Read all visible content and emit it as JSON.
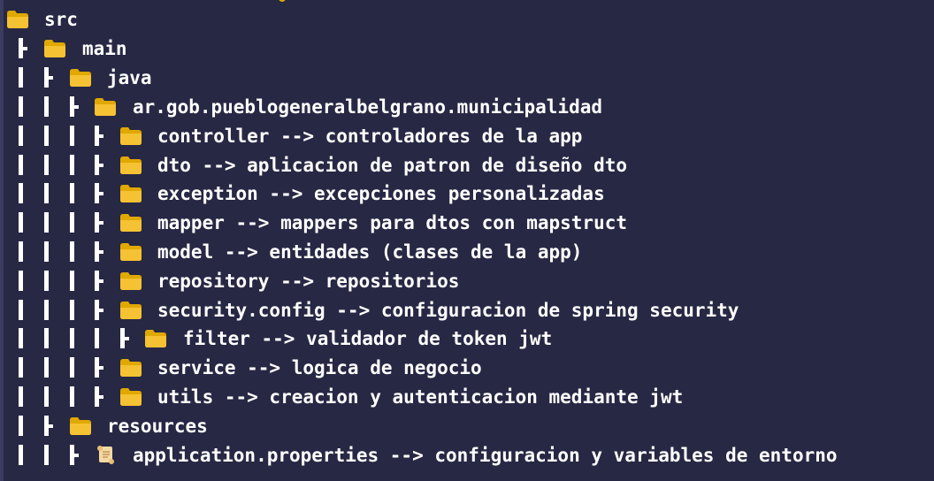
{
  "tree": [
    {
      "label": "src",
      "icon": "folder-icon"
    },
    {
      "label": "main",
      "icon": "folder-icon"
    },
    {
      "label": "java",
      "icon": "folder-icon"
    },
    {
      "label": "ar.gob.pueblogeneralbelgrano.municipalidad",
      "icon": "folder-icon"
    },
    {
      "label": "controller --> controladores de la app",
      "icon": "folder-icon"
    },
    {
      "label": "dto --> aplicacion de patron de diseño dto",
      "icon": "folder-icon"
    },
    {
      "label": "exception --> excepciones personalizadas",
      "icon": "folder-icon"
    },
    {
      "label": "mapper --> mappers para dtos con mapstruct",
      "icon": "folder-icon"
    },
    {
      "label": "model --> entidades (clases de la app)",
      "icon": "folder-icon"
    },
    {
      "label": "repository --> repositorios",
      "icon": "folder-icon"
    },
    {
      "label": "security.config --> configuracion de spring security",
      "icon": "folder-icon"
    },
    {
      "label": "filter --> validador de token jwt",
      "icon": "folder-icon"
    },
    {
      "label": "service --> logica de negocio",
      "icon": "folder-icon"
    },
    {
      "label": "utils --> creacion y autenticacion mediante jwt",
      "icon": "folder-icon"
    },
    {
      "label": "resources",
      "icon": "folder-icon"
    },
    {
      "label": "application.properties --> configuracion y variables de entorno",
      "icon": "scroll-file-icon"
    }
  ],
  "colors": {
    "background": "#272844",
    "text": "#ffffff",
    "folder": "#f5c233",
    "folder_tab": "#e0a800",
    "file": "#f3d9a4"
  }
}
